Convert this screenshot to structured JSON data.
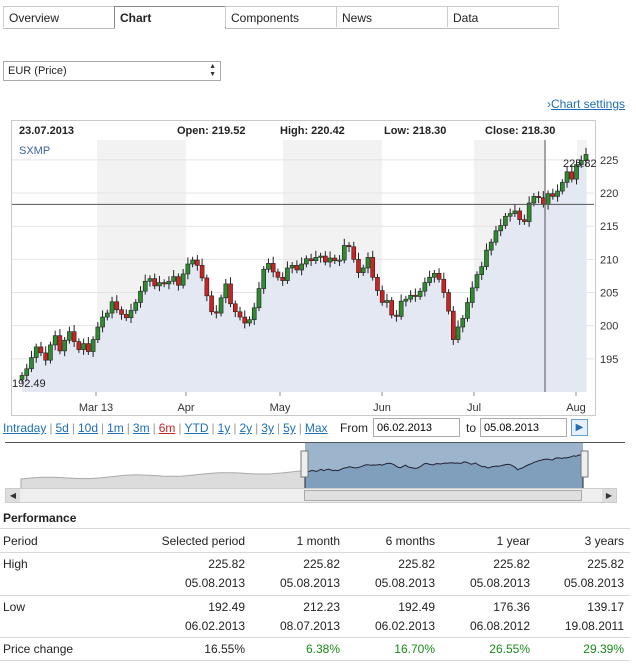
{
  "tabs": [
    "Overview",
    "Chart",
    "Components",
    "News",
    "Data"
  ],
  "currency_select": {
    "value": "EUR (Price)"
  },
  "chart_settings_label": "Chart settings",
  "ohlc": {
    "date": "23.07.2013",
    "open": "Open: 219.52",
    "high": "High: 220.42",
    "low": "Low: 218.30",
    "close": "Close: 218.30"
  },
  "chart_data": {
    "type": "candlestick",
    "series_name": "SXMP",
    "x_labels": [
      "Mar 13",
      "Apr",
      "May",
      "Jun",
      "Jul",
      "Aug"
    ],
    "y_ticks": [
      195,
      200,
      205,
      210,
      215,
      220,
      225
    ],
    "ylim": [
      190,
      228
    ],
    "last_label": "225.82",
    "first_label": "192.49",
    "crosshair_value": 218.3,
    "closes": [
      192.49,
      193.5,
      195.2,
      196.8,
      195.9,
      194.8,
      197.1,
      198.5,
      196.2,
      197.8,
      199.1,
      197.6,
      196.4,
      197.3,
      196.1,
      197.9,
      199.8,
      201.3,
      201.9,
      203.6,
      202.4,
      201.7,
      201.2,
      202.3,
      203.5,
      205.2,
      206.7,
      207.1,
      206.0,
      206.5,
      206.3,
      206.7,
      207.4,
      206.1,
      207.8,
      209.3,
      209.9,
      209.1,
      207.2,
      204.5,
      202.1,
      201.9,
      204.2,
      206.3,
      203.3,
      202.1,
      201.3,
      200.4,
      200.9,
      202.7,
      205.6,
      208.5,
      209.4,
      208.1,
      207.3,
      206.8,
      208.7,
      209.1,
      208.4,
      209.3,
      210.1,
      209.8,
      210.3,
      210.5,
      209.6,
      210.2,
      209.8,
      209.9,
      212.1,
      211.9,
      210.0,
      208.0,
      208.7,
      210.3,
      207.3,
      205.3,
      203.5,
      203.8,
      201.6,
      201.4,
      203.7,
      204.0,
      204.6,
      204.4,
      205.2,
      206.5,
      207.3,
      207.9,
      207.0,
      205.0,
      202.2,
      197.9,
      199.8,
      201.1,
      203.5,
      205.7,
      207.7,
      208.9,
      211.4,
      212.6,
      214.3,
      215.1,
      216.5,
      216.9,
      217.3,
      216.0,
      215.7,
      218.5,
      219.5,
      219.3,
      218.3,
      219.9,
      219.5,
      220.3,
      221.6,
      223.2,
      222.1,
      224.3,
      224.9,
      225.82
    ]
  },
  "range_links": [
    "Intraday",
    "5d",
    "10d",
    "1m",
    "3m",
    "6m",
    "YTD",
    "1y",
    "2y",
    "3y",
    "5y",
    "Max"
  ],
  "selected_range": "6m",
  "from_label": "From",
  "to_label": "to",
  "from_date": "06.02.2013",
  "to_date": "05.08.2013",
  "performance": {
    "title": "Performance",
    "headers": [
      "Period",
      "Selected period",
      "1 month",
      "6 months",
      "1 year",
      "3 years"
    ],
    "high_label": "High",
    "high_values": [
      "225.82",
      "225.82",
      "225.82",
      "225.82",
      "225.82"
    ],
    "high_dates": [
      "05.08.2013",
      "05.08.2013",
      "05.08.2013",
      "05.08.2013",
      "05.08.2013"
    ],
    "low_label": "Low",
    "low_values": [
      "192.49",
      "212.23",
      "192.49",
      "176.36",
      "139.17"
    ],
    "low_dates": [
      "06.02.2013",
      "08.07.2013",
      "06.02.2013",
      "06.08.2012",
      "19.08.2011"
    ],
    "change_label": "Price change",
    "change_values": [
      "16.55%",
      "6.38%",
      "16.70%",
      "26.55%",
      "29.39%"
    ]
  },
  "colors": {
    "up": "#2e8b2e",
    "down": "#cc2222",
    "area": "#e3e8f2",
    "link": "#1e6fb8",
    "positive": "#1a8a1a"
  }
}
